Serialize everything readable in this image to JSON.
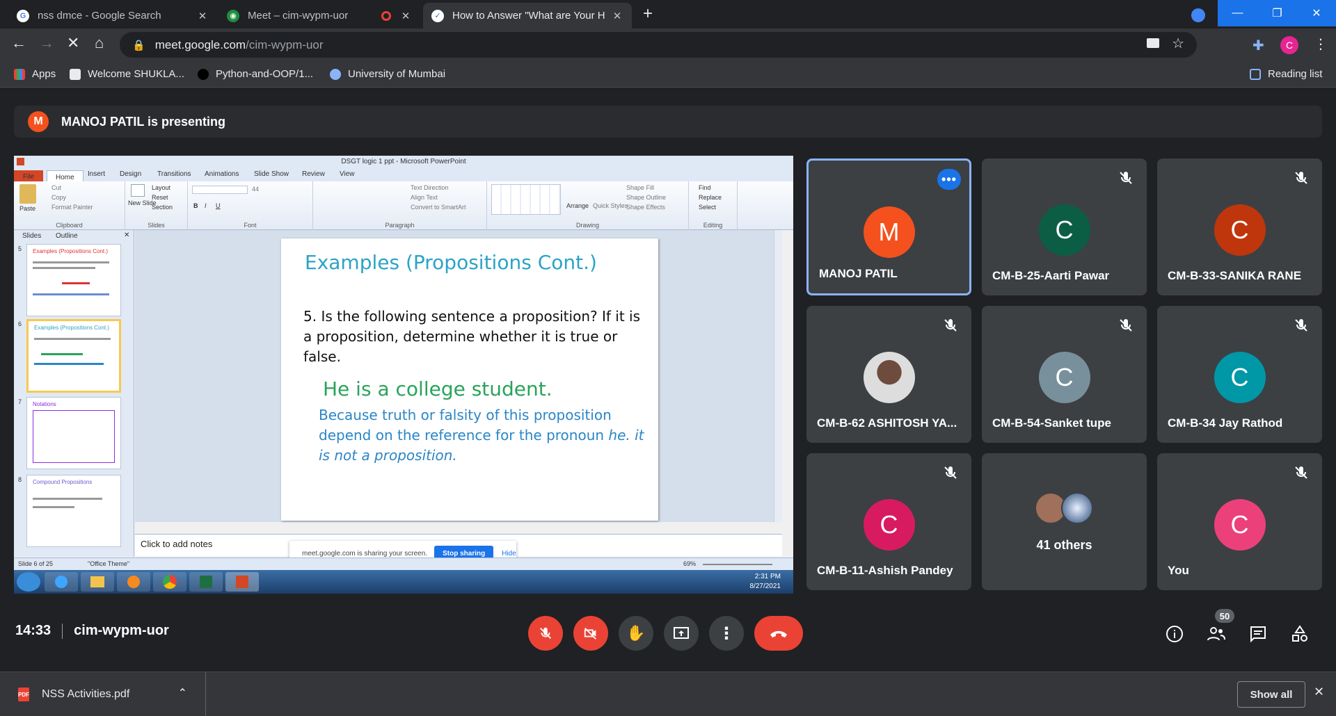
{
  "browser": {
    "tabs": [
      {
        "title": "nss dmce - Google Search",
        "favicon": "google-icon",
        "active": false
      },
      {
        "title": "Meet – cim-wypm-uor",
        "favicon": "meet-icon",
        "active": false
      },
      {
        "title": "How to Answer \"What are Your H",
        "favicon": "article-icon",
        "active": true
      }
    ],
    "url_host": "meet.google.com",
    "url_path": "/cim-wypm-uor",
    "profile_initial": "C",
    "bookmarks": [
      {
        "label": "Apps",
        "icon": "apps-grid-icon"
      },
      {
        "label": "Welcome SHUKLA...",
        "icon": "site-icon"
      },
      {
        "label": "Python-and-OOP/1...",
        "icon": "github-icon"
      },
      {
        "label": "University of Mumbai",
        "icon": "globe-icon"
      }
    ],
    "reading_list": "Reading list"
  },
  "meet": {
    "presenter_initial": "M",
    "presenter_text": "MANOJ PATIL is presenting",
    "meeting_time": "14:33",
    "meeting_code": "cim-wypm-uor",
    "participant_count": "50",
    "participants": [
      {
        "name": "MANOJ PATIL",
        "initial": "M",
        "color": "#f4511e",
        "muted": false,
        "selected": true
      },
      {
        "name": "CM-B-25-Aarti Pawar",
        "initial": "C",
        "color": "#0b5e43",
        "muted": true,
        "selected": false
      },
      {
        "name": "CM-B-33-SANIKA RANE",
        "initial": "C",
        "color": "#bf360c",
        "muted": true,
        "selected": false
      },
      {
        "name": "CM-B-62 ASHITOSH YA...",
        "initial": "",
        "color": "#8d8d8d",
        "muted": true,
        "selected": false
      },
      {
        "name": "CM-B-54-Sanket tupe",
        "initial": "C",
        "color": "#78909c",
        "muted": true,
        "selected": false
      },
      {
        "name": "CM-B-34 Jay Rathod",
        "initial": "C",
        "color": "#0097a7",
        "muted": true,
        "selected": false
      },
      {
        "name": "CM-B-11-Ashish Pandey",
        "initial": "C",
        "color": "#d81b60",
        "muted": true,
        "selected": false
      },
      {
        "name": "41 others",
        "initial": "",
        "color": "#3c4043",
        "muted": false,
        "selected": false
      },
      {
        "name": "You",
        "initial": "C",
        "color": "#ec407a",
        "muted": true,
        "selected": false
      }
    ]
  },
  "downloads": {
    "file": "NSS Activities.pdf",
    "show_all": "Show all"
  },
  "powerpoint": {
    "window_title": "DSGT logic 1 ppt - Microsoft PowerPoint",
    "tabs": [
      "File",
      "Home",
      "Insert",
      "Design",
      "Transitions",
      "Animations",
      "Slide Show",
      "Review",
      "View"
    ],
    "ribbon": {
      "clipboard": {
        "label": "Clipboard",
        "paste": "Paste",
        "cut": "Cut",
        "copy": "Copy",
        "format_painter": "Format Painter"
      },
      "slides": {
        "label": "Slides",
        "new_slide": "New Slide",
        "layout": "Layout",
        "reset": "Reset",
        "section": "Section"
      },
      "font": {
        "label": "Font",
        "size": "44"
      },
      "paragraph": {
        "label": "Paragraph",
        "text_direction": "Text Direction",
        "align_text": "Align Text",
        "smartart": "Convert to SmartArt"
      },
      "drawing": {
        "label": "Drawing",
        "arrange": "Arrange",
        "quick_styles": "Quick Styles",
        "shape_fill": "Shape Fill",
        "shape_outline": "Shape Outline",
        "shape_effects": "Shape Effects"
      },
      "editing": {
        "label": "Editing",
        "find": "Find",
        "replace": "Replace",
        "select": "Select"
      }
    },
    "panel_tabs": [
      "Slides",
      "Outline"
    ],
    "thumbnails": [
      {
        "num": "5",
        "title": "Examples (Propositions Cont.)"
      },
      {
        "num": "6",
        "title": "Examples (Propositions Cont.)"
      },
      {
        "num": "7",
        "title": "Notations"
      },
      {
        "num": "8",
        "title": "Compound Propositions"
      }
    ],
    "slide": {
      "title": "Examples (Propositions Cont.)",
      "question": "5. Is the following sentence a proposition? If it is a proposition, determine whether it is true or false.",
      "example": "He is a college student.",
      "explanation": "Because truth or falsity of this proposition depend on the reference for the pronoun",
      "explanation_italic": "he. it is not a proposition."
    },
    "notes_placeholder": "Click to add notes",
    "status_left": "Slide 6 of 25",
    "status_theme": "\"Office Theme\"",
    "zoom": "69%",
    "share_bar": {
      "text": "meet.google.com is sharing your screen.",
      "stop": "Stop sharing",
      "hide": "Hide"
    },
    "clock_time": "2:31 PM",
    "clock_date": "8/27/2021"
  }
}
